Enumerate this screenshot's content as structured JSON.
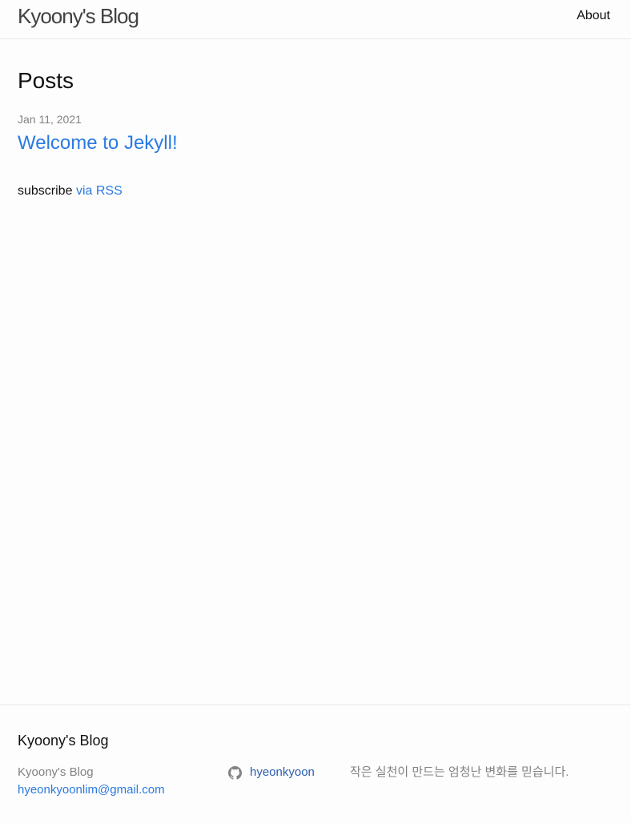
{
  "header": {
    "site_title": "Kyoony's Blog",
    "nav": [
      {
        "label": "About"
      }
    ]
  },
  "main": {
    "heading": "Posts",
    "posts": [
      {
        "date": "Jan 11, 2021",
        "title": "Welcome to Jekyll!"
      }
    ],
    "rss": {
      "prefix": "subscribe",
      "link_label": "via RSS"
    }
  },
  "footer": {
    "heading": "Kyoony's Blog",
    "name": "Kyoony's Blog",
    "email": "hyeonkyoonlim@gmail.com",
    "github": {
      "icon": "github-icon",
      "username": "hyeonkyoon"
    },
    "description": "작은 실천이 만드는 엄청난 변화를 믿습니다."
  },
  "colors": {
    "background": "#fdfdfd",
    "link": "#2a7ae2",
    "muted": "#828282",
    "border": "#e8e8e8"
  }
}
